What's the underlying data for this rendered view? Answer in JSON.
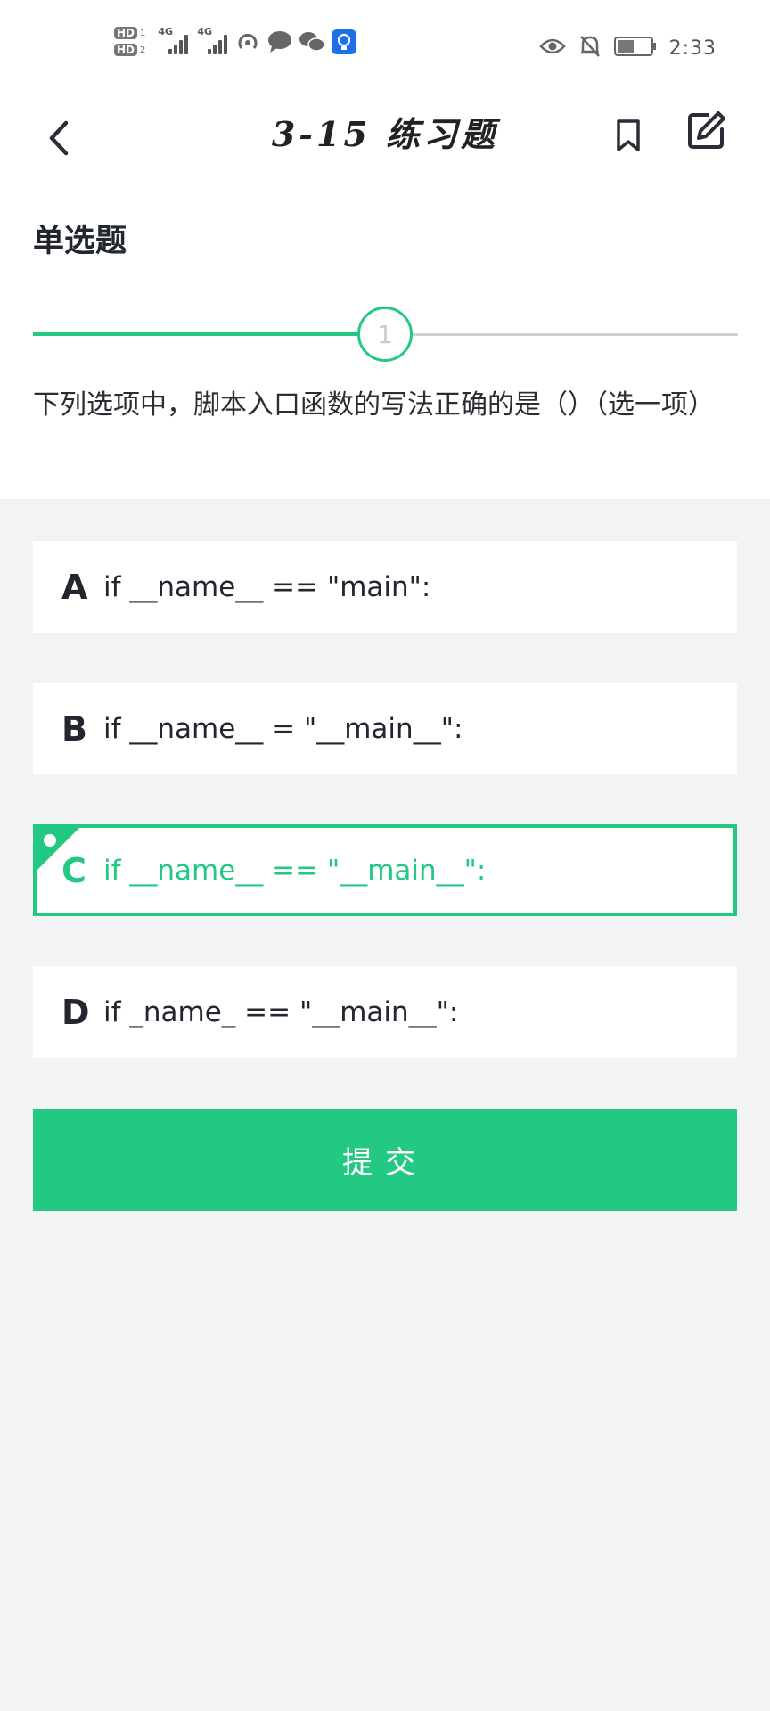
{
  "status_bar": {
    "hd_labels": [
      "HD",
      "HD"
    ],
    "sim_numbers": [
      "1",
      "2"
    ],
    "network_labels": [
      "4G",
      "4G"
    ],
    "time": "2:33"
  },
  "header": {
    "title": "3-15 练习题"
  },
  "question": {
    "type": "单选题",
    "number": "1",
    "progress": 0.5,
    "text": "下列选项中，脚本入口函数的写法正确的是（）（选一项）"
  },
  "options": [
    {
      "letter": "A",
      "text": "if __name__ == \"main\":",
      "selected": false
    },
    {
      "letter": "B",
      "text": "if __name__ = \"__main__\":",
      "selected": false
    },
    {
      "letter": "C",
      "text": "if __name__ == \"__main__\":",
      "selected": true
    },
    {
      "letter": "D",
      "text": "if _name_ == \"__main__\":",
      "selected": false
    }
  ],
  "submit_label": "提交",
  "colors": {
    "accent": "#23c882",
    "background": "#f2f3f5",
    "card": "#ffffff",
    "text": "#22262f"
  }
}
